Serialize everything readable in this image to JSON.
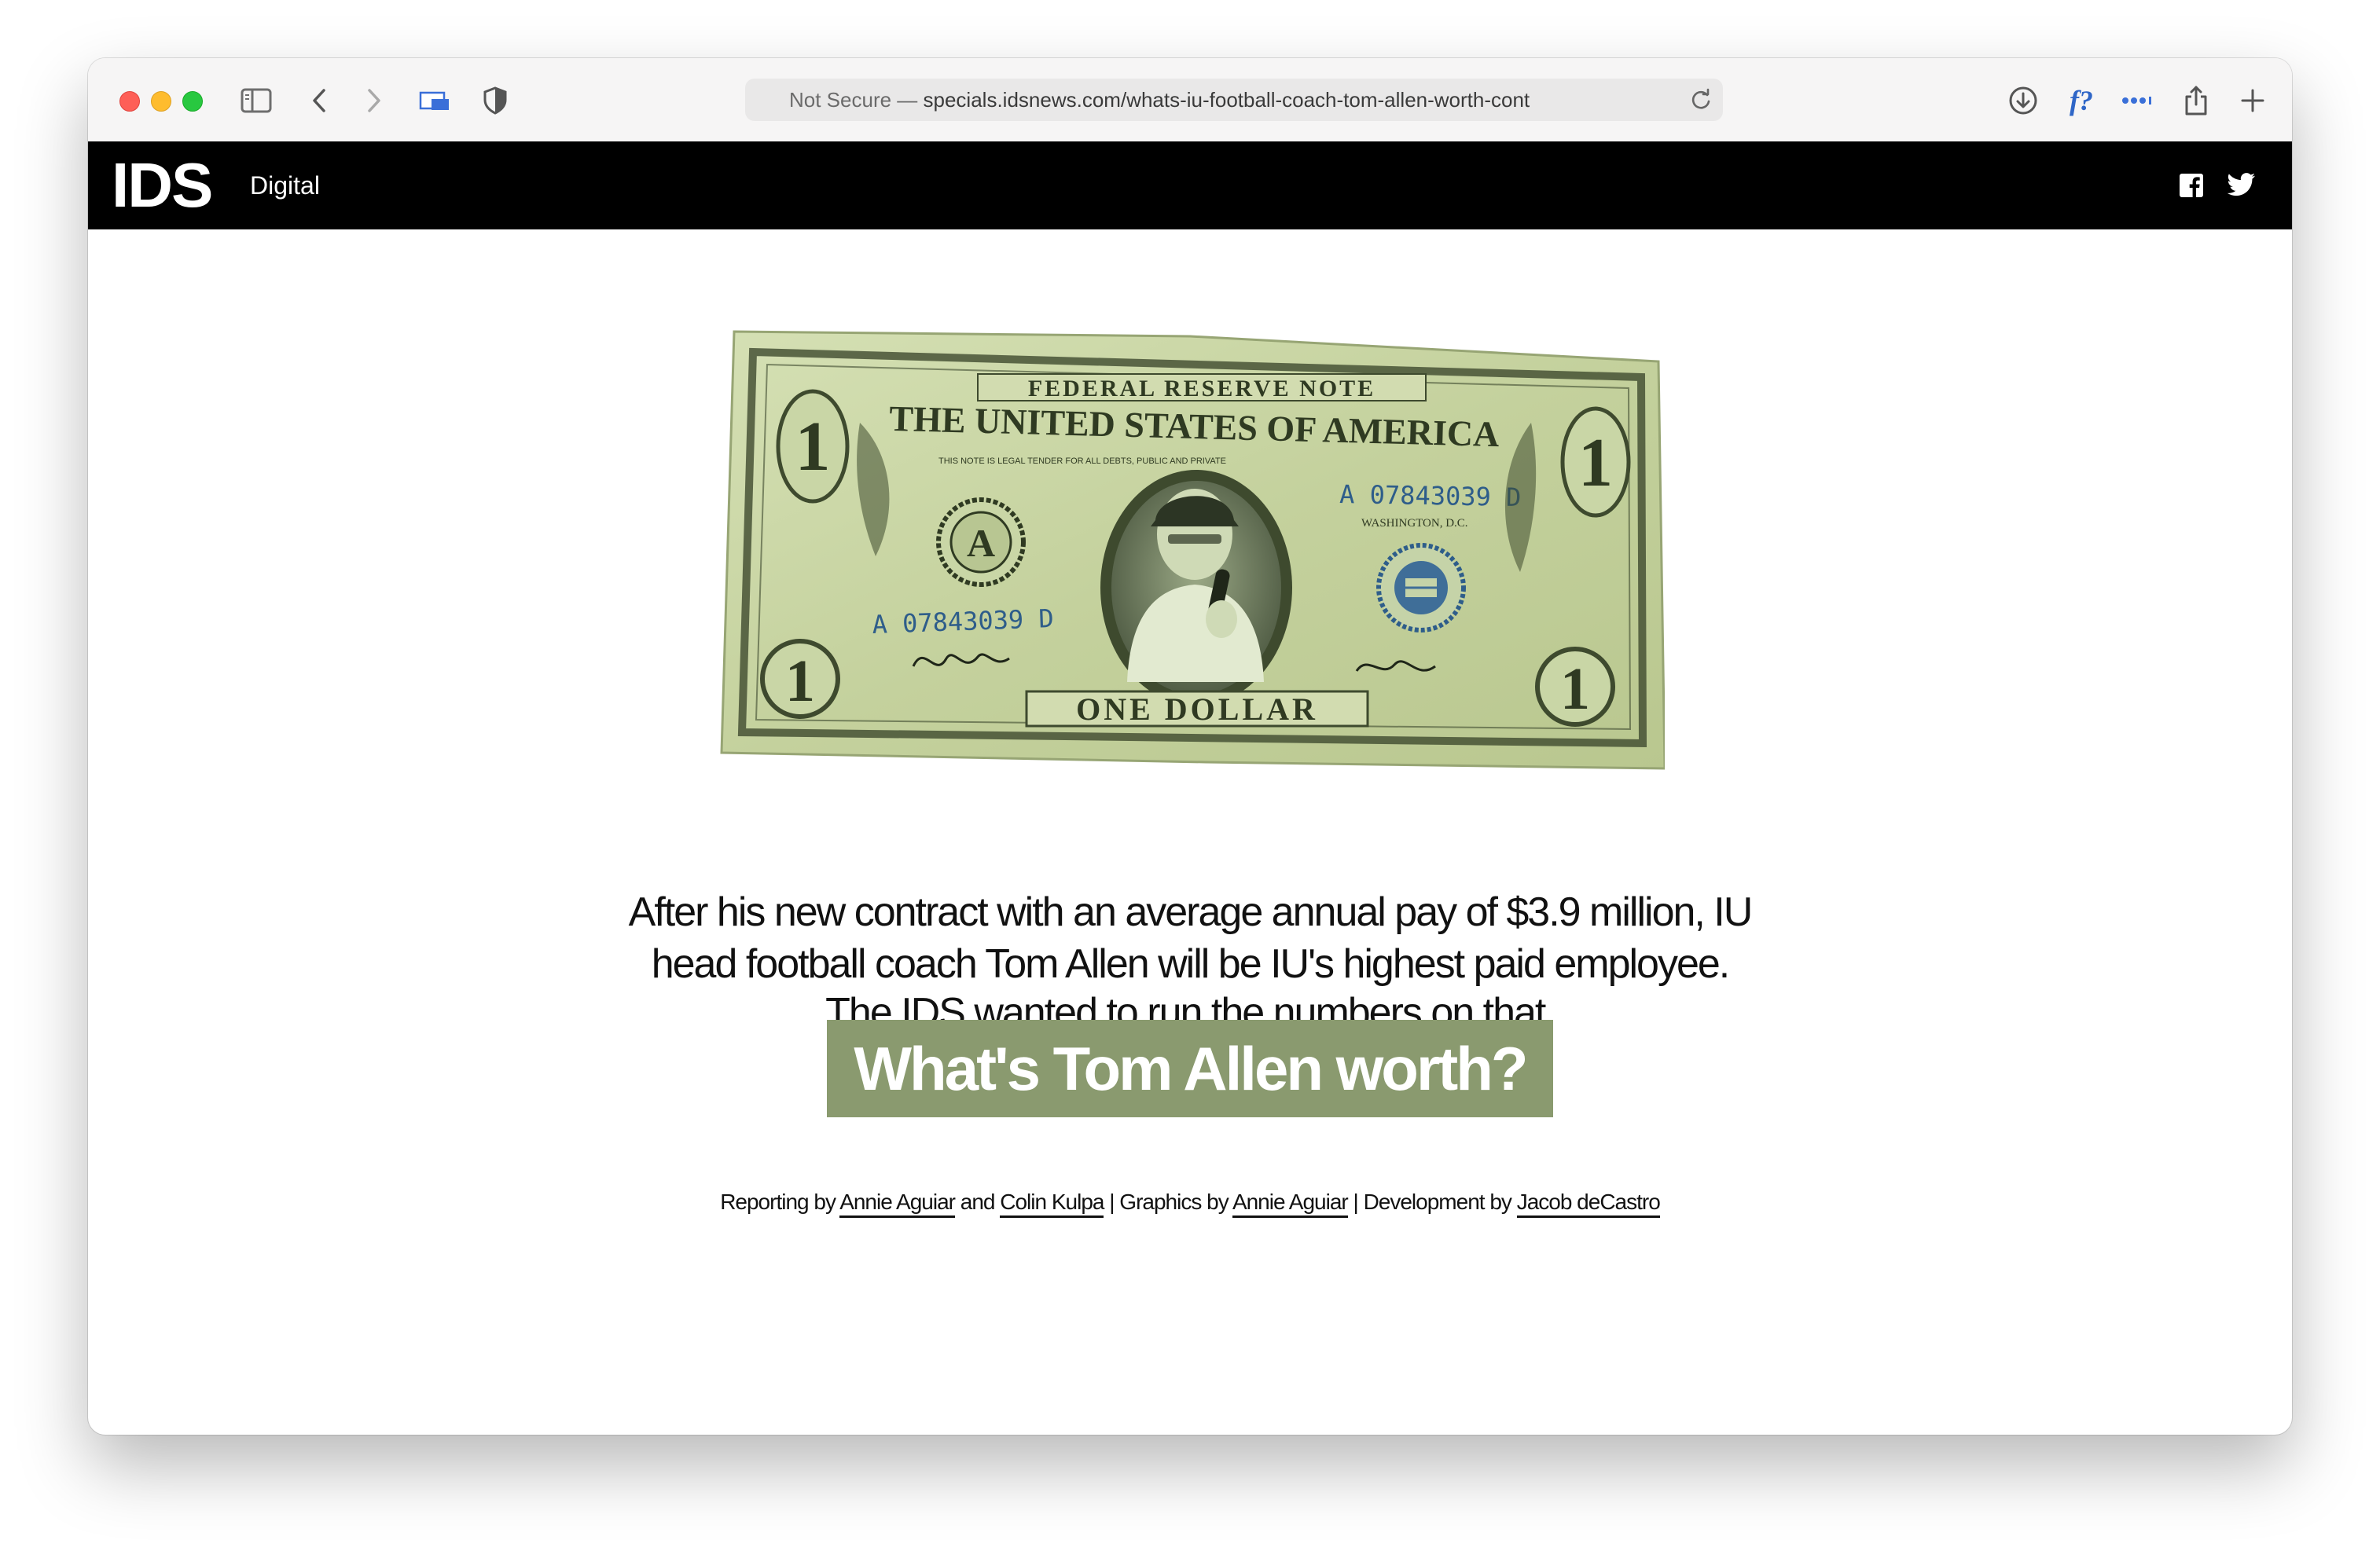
{
  "browser": {
    "url_prefix": "Not Secure — ",
    "url": "specials.idsnews.com/whats-iu-football-coach-tom-allen-worth-cont",
    "icons": [
      "sidebar-icon",
      "back-icon",
      "forward-icon",
      "tab-overview-icon",
      "shield-icon",
      "reload-icon",
      "download-icon",
      "formula-extension-icon",
      "more-icon",
      "share-icon",
      "new-tab-icon"
    ],
    "formula_label": "f?"
  },
  "site": {
    "logo": "IDS",
    "logo_sub": "Digital",
    "social": [
      "facebook-icon",
      "twitter-icon"
    ]
  },
  "bill": {
    "banner": "FEDERAL RESERVE NOTE",
    "country": "THE UNITED STATES OF AMERICA",
    "tender": "THIS NOTE IS LEGAL TENDER FOR ALL DEBTS, PUBLIC AND PRIVATE",
    "serial": "A 07843039 D",
    "location": "WASHINGTON, D.C.",
    "denomination": "ONE DOLLAR",
    "seal_letter": "A",
    "numeral": "1",
    "colors": {
      "paper": "#c9d6a6",
      "ink": "#3e4a2e",
      "serial": "#2e5d8a"
    }
  },
  "intro": {
    "line1": "After his new contract with an average annual pay of $3.9 million, IU",
    "line2": "head football coach Tom Allen will be IU's highest paid employee.",
    "line3": "The IDS wanted to run the numbers on that."
  },
  "cta": {
    "label": "What's Tom Allen worth?",
    "color": "#8a9a6f"
  },
  "credits": {
    "reporting_label": "Reporting by ",
    "reporter1": "Annie Aguiar",
    "and": " and ",
    "reporter2": "Colin Kulpa",
    "graphics_label": " | Graphics by ",
    "graphics": "Annie Aguiar",
    "dev_label": " | Development by ",
    "developer": "Jacob deCastro"
  }
}
